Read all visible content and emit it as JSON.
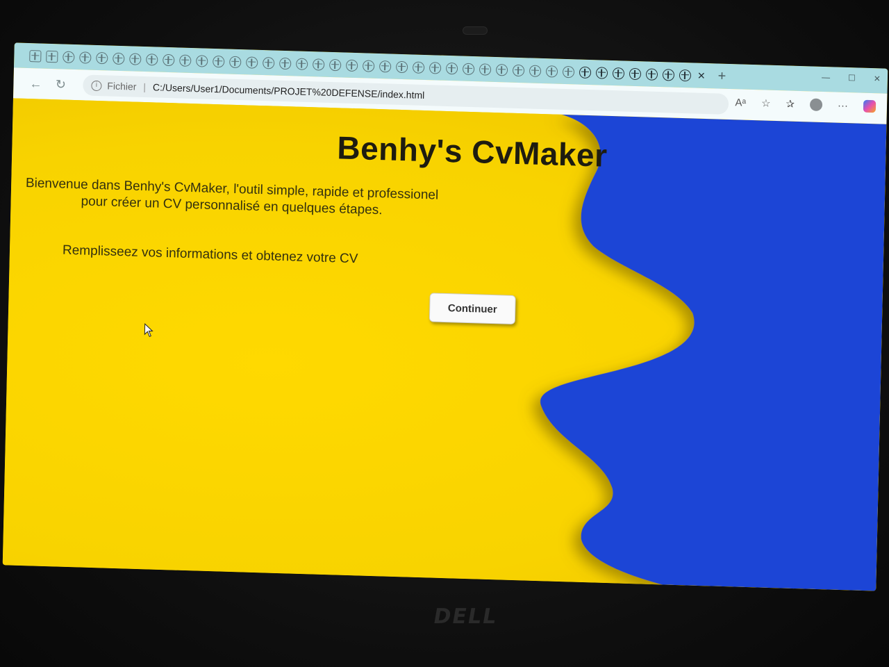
{
  "browser": {
    "tab_count_icons": 38,
    "address": {
      "scheme_label": "Fichier",
      "separator": "|",
      "url": "C:/Users/User1/Documents/PROJET%20DEFENSE/index.html"
    }
  },
  "page": {
    "title": "Benhy's CvMaker",
    "intro": "Bienvenue dans Benhy's CvMaker, l'outil simple, rapide et professionel pour créer un CV personnalisé en quelques étapes.",
    "instruction": "Remplisseez vos informations et obtenez votre CV",
    "continue_label": "Continuer"
  },
  "colors": {
    "background_yellow": "#f8d300",
    "wave_blue": "#1f45d6",
    "tabbar": "#a9dbe1"
  },
  "device": {
    "brand": "DELL"
  }
}
